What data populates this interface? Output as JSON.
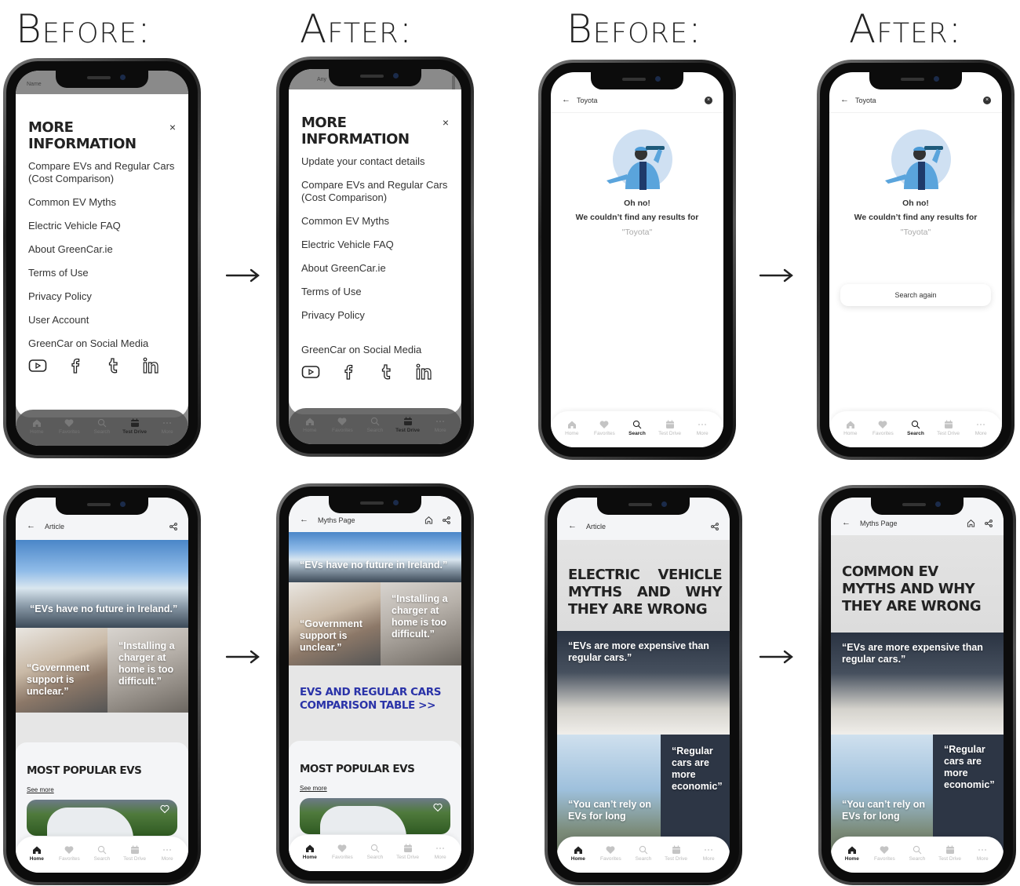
{
  "headings": {
    "before_1": "Before:",
    "after_1": "After:",
    "before_2": "Before:",
    "after_2": "After:"
  },
  "tabbar": {
    "tabs": [
      {
        "label": "Home",
        "icon": "home-icon"
      },
      {
        "label": "Favorites",
        "icon": "heart-icon"
      },
      {
        "label": "Search",
        "icon": "search-icon"
      },
      {
        "label": "Test Drive",
        "icon": "calendar-icon"
      },
      {
        "label": "More",
        "icon": "more-dots-icon"
      }
    ]
  },
  "phone1": {
    "background_label": "Name",
    "title": "MORE INFORMATION",
    "close": "×",
    "menu": [
      "Compare EVs and Regular Cars (Cost Comparison)",
      "Common EV Myths",
      "Electric Vehicle FAQ",
      "About GreenCar.ie",
      "Terms of Use",
      "Privacy Policy",
      "User Account",
      "GreenCar on Social Media"
    ],
    "active_tab": "Test Drive"
  },
  "phone2": {
    "background_label": "Any",
    "title": "MORE INFORMATION",
    "close": "×",
    "menu": [
      "Update your contact details",
      "Compare EVs and Regular Cars (Cost Comparison)",
      "Common EV Myths",
      "Electric Vehicle FAQ",
      "About GreenCar.ie",
      "Terms of Use",
      "Privacy Policy",
      "GreenCar on Social Media"
    ],
    "active_tab": "Test Drive"
  },
  "phone3": {
    "search_value": "Toyota",
    "clear": "×",
    "oh_no": "Oh no!",
    "message": "We couldn’t find any results for",
    "query": "\"Toyota\"",
    "active_tab": "Search"
  },
  "phone4": {
    "search_value": "Toyota",
    "clear": "×",
    "oh_no": "Oh no!",
    "message": "We couldn’t find any results for",
    "query": "\"Toyota\"",
    "search_again": "Search again",
    "active_tab": "Search"
  },
  "phone5": {
    "page_title": "Article",
    "quote_banner": "“EVs have no future in Ireland.”",
    "quote_government": "“Government support is unclear.”",
    "quote_charger": "“Installing a charger at home is too difficult.”",
    "popular_title": "MOST POPULAR EVS",
    "see_more": "See more",
    "active_tab": "Home"
  },
  "phone6": {
    "page_title": "Myths Page",
    "quote_banner": "“EVs have no future in Ireland.”",
    "quote_government": "“Government support is unclear.”",
    "quote_charger": "“Installing a charger at home is too difficult.”",
    "compare_link": "EVS AND REGULAR CARS COMPARISON TABLE >>",
    "popular_title": "MOST POPULAR EVS",
    "see_more": "See more",
    "active_tab": "Home"
  },
  "phone7": {
    "page_title": "Article",
    "hero_title": "ELECTRIC VEHICLE MYTHS AND WHY THEY ARE WRONG",
    "quote_expensive": "“EVs are more expensive than regular cars.”",
    "quote_economic": "“Regular cars are more economic”",
    "quote_rely": "“You can’t rely on EVs for long",
    "active_tab": "Home"
  },
  "phone8": {
    "page_title": "Myths Page",
    "hero_title": "COMMON EV MYTHS AND WHY THEY ARE WRONG",
    "quote_expensive": "“EVs are more expensive than regular cars.”",
    "quote_economic": "“Regular cars are more economic”",
    "quote_rely": "“You can’t rely on EVs for long",
    "active_tab": "Home"
  }
}
